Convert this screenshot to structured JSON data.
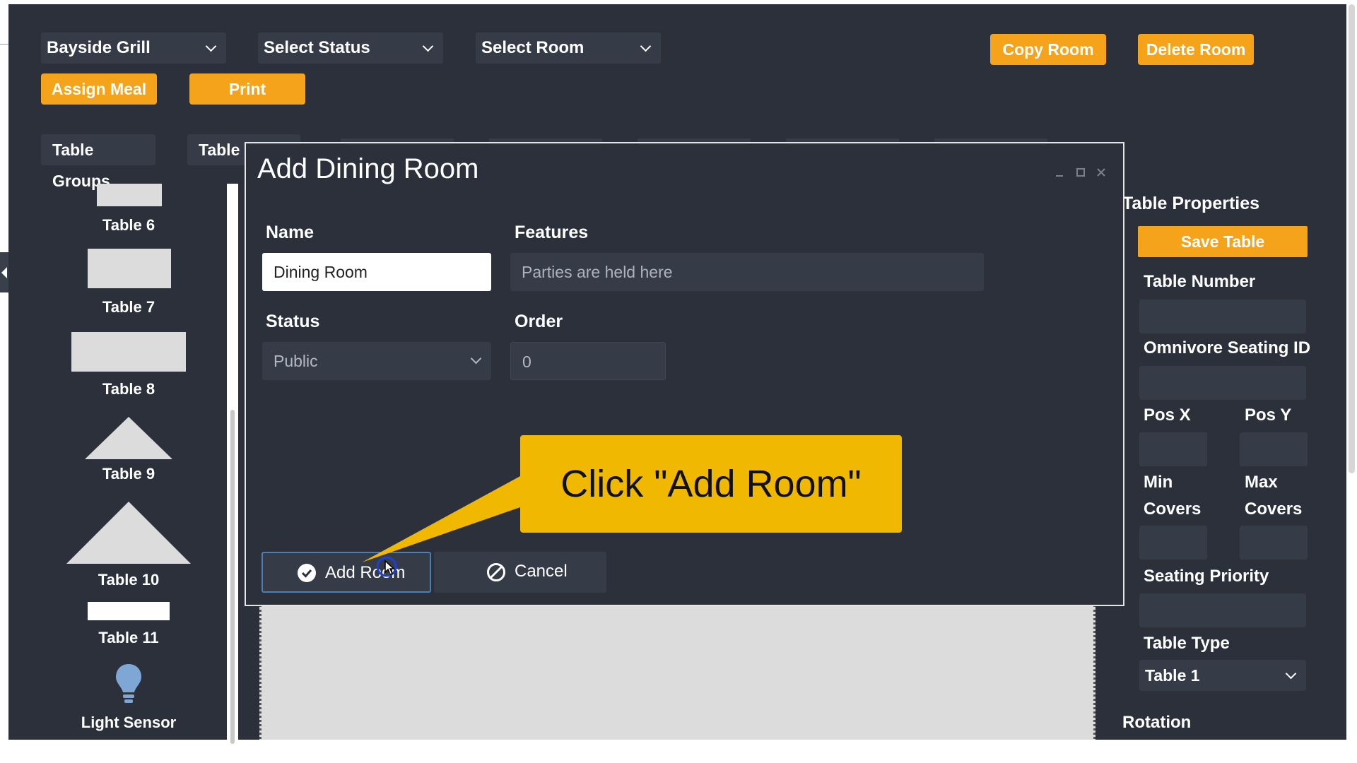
{
  "toolbar": {
    "restaurant_select": "Bayside Grill",
    "status_select": "Select Status",
    "room_select": "Select Room",
    "copy_room": "Copy Room",
    "delete_room": "Delete Room",
    "assign_meal": "Assign Meal",
    "print": "Print"
  },
  "tabs": {
    "table_groups": "Table Groups",
    "table_partial": "Table P"
  },
  "palette": {
    "items": [
      {
        "label": "Table 6",
        "icon": "table-rect-small-icon"
      },
      {
        "label": "Table 7",
        "icon": "table-rect-icon"
      },
      {
        "label": "Table 8",
        "icon": "table-rect-wide-icon"
      },
      {
        "label": "Table 9",
        "icon": "table-triangle-small-icon"
      },
      {
        "label": "Table 10",
        "icon": "table-triangle-large-icon"
      },
      {
        "label": "Table 11",
        "icon": "table-bar-icon"
      },
      {
        "label": "Light Sensor",
        "icon": "light-bulb-icon"
      }
    ]
  },
  "modal": {
    "title": "Add Dining Room",
    "name_label": "Name",
    "name_value": "Dining Room",
    "features_label": "Features",
    "features_placeholder": "Parties are held here",
    "status_label": "Status",
    "status_value": "Public",
    "order_label": "Order",
    "order_value": "0",
    "add_button": "Add Room",
    "cancel_button": "Cancel"
  },
  "callout": {
    "text": "Click \"Add Room\""
  },
  "table_properties": {
    "heading": "Table Properties",
    "save_button": "Save Table",
    "table_number_label": "Table Number",
    "omnivore_label": "Omnivore Seating ID",
    "pos_x_label": "Pos X",
    "pos_y_label": "Pos Y",
    "min_covers_label": "Min Covers",
    "max_covers_label": "Max Covers",
    "seating_priority_label": "Seating Priority",
    "table_type_label": "Table Type",
    "table_type_value": "Table 1",
    "rotation_label": "Rotation"
  },
  "colors": {
    "background": "#2b303b",
    "accent_orange": "#f6a31c",
    "callout_yellow": "#f1b800",
    "field_dark": "#353b47"
  }
}
